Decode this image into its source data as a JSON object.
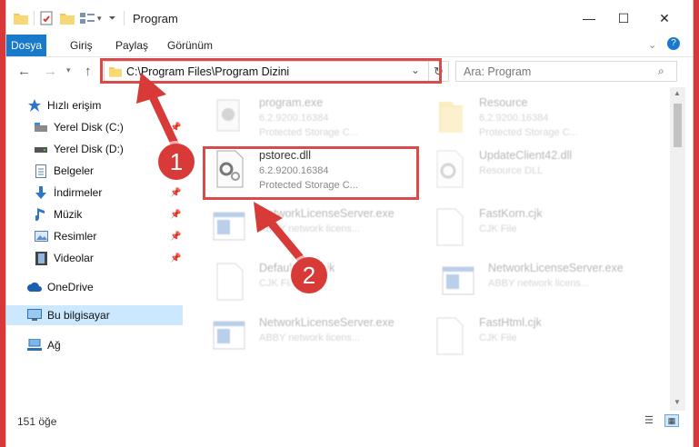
{
  "window": {
    "title": "Program",
    "minimize": "—",
    "maximize": "☐",
    "close": "✕"
  },
  "ribbon": {
    "tabs": [
      "Dosya",
      "Giriş",
      "Paylaş",
      "Görünüm"
    ]
  },
  "address": {
    "path": "C:\\Program Files\\Program Dizini",
    "search_placeholder": "Ara: Program"
  },
  "sidebar": {
    "items": [
      {
        "label": "Hızlı erişim",
        "icon": "star-icon"
      },
      {
        "label": "Yerel Disk (C:)",
        "icon": "drive-icon"
      },
      {
        "label": "Yerel Disk (D:)",
        "icon": "drive-icon"
      },
      {
        "label": "Belgeler",
        "icon": "documents-icon"
      },
      {
        "label": "İndirmeler",
        "icon": "download-icon"
      },
      {
        "label": "Müzik",
        "icon": "music-icon"
      },
      {
        "label": "Resimler",
        "icon": "pictures-icon"
      },
      {
        "label": "Videolar",
        "icon": "video-icon"
      },
      {
        "label": "OneDrive",
        "icon": "cloud-icon"
      },
      {
        "label": "Bu bilgisayar",
        "icon": "computer-icon"
      },
      {
        "label": "Ağ",
        "icon": "network-icon"
      }
    ]
  },
  "files": [
    {
      "name": "program.exe",
      "l2": "6.2.9200.16384",
      "l3": "Protected Storage C..."
    },
    {
      "name": "Resource",
      "l2": "6.2.9200.16384",
      "l3": "Protected Storage C..."
    },
    {
      "name": "pstorec.dll",
      "l2": "6.2.9200.16384",
      "l3": "Protected Storage C..."
    },
    {
      "name": "UpdateClient42.dll",
      "l2": "Resource DLL",
      "l3": ""
    },
    {
      "name": "NetworkLicenseServer.exe",
      "l2": "ABBY network licens...",
      "l3": ""
    },
    {
      "name": "FastKorn.cjk",
      "l2": "CJK File",
      "l3": ""
    },
    {
      "name": "DefaultFont.cjk",
      "l2": "CJK File",
      "l3": ""
    },
    {
      "name": "NetworkLicenseServer.exe",
      "l2": "ABBY network licens...",
      "l3": ""
    },
    {
      "name": "NetworkLicenseServer.exe",
      "l2": "ABBY network licens...",
      "l3": ""
    },
    {
      "name": "FastHtml.cjk",
      "l2": "CJK File",
      "l3": ""
    }
  ],
  "status": {
    "count": "151 öğe"
  },
  "annotations": {
    "step1": "1",
    "step2": "2"
  },
  "colors": {
    "accent": "#1979ca",
    "highlight": "#d94a48",
    "selection": "#cce8ff"
  }
}
